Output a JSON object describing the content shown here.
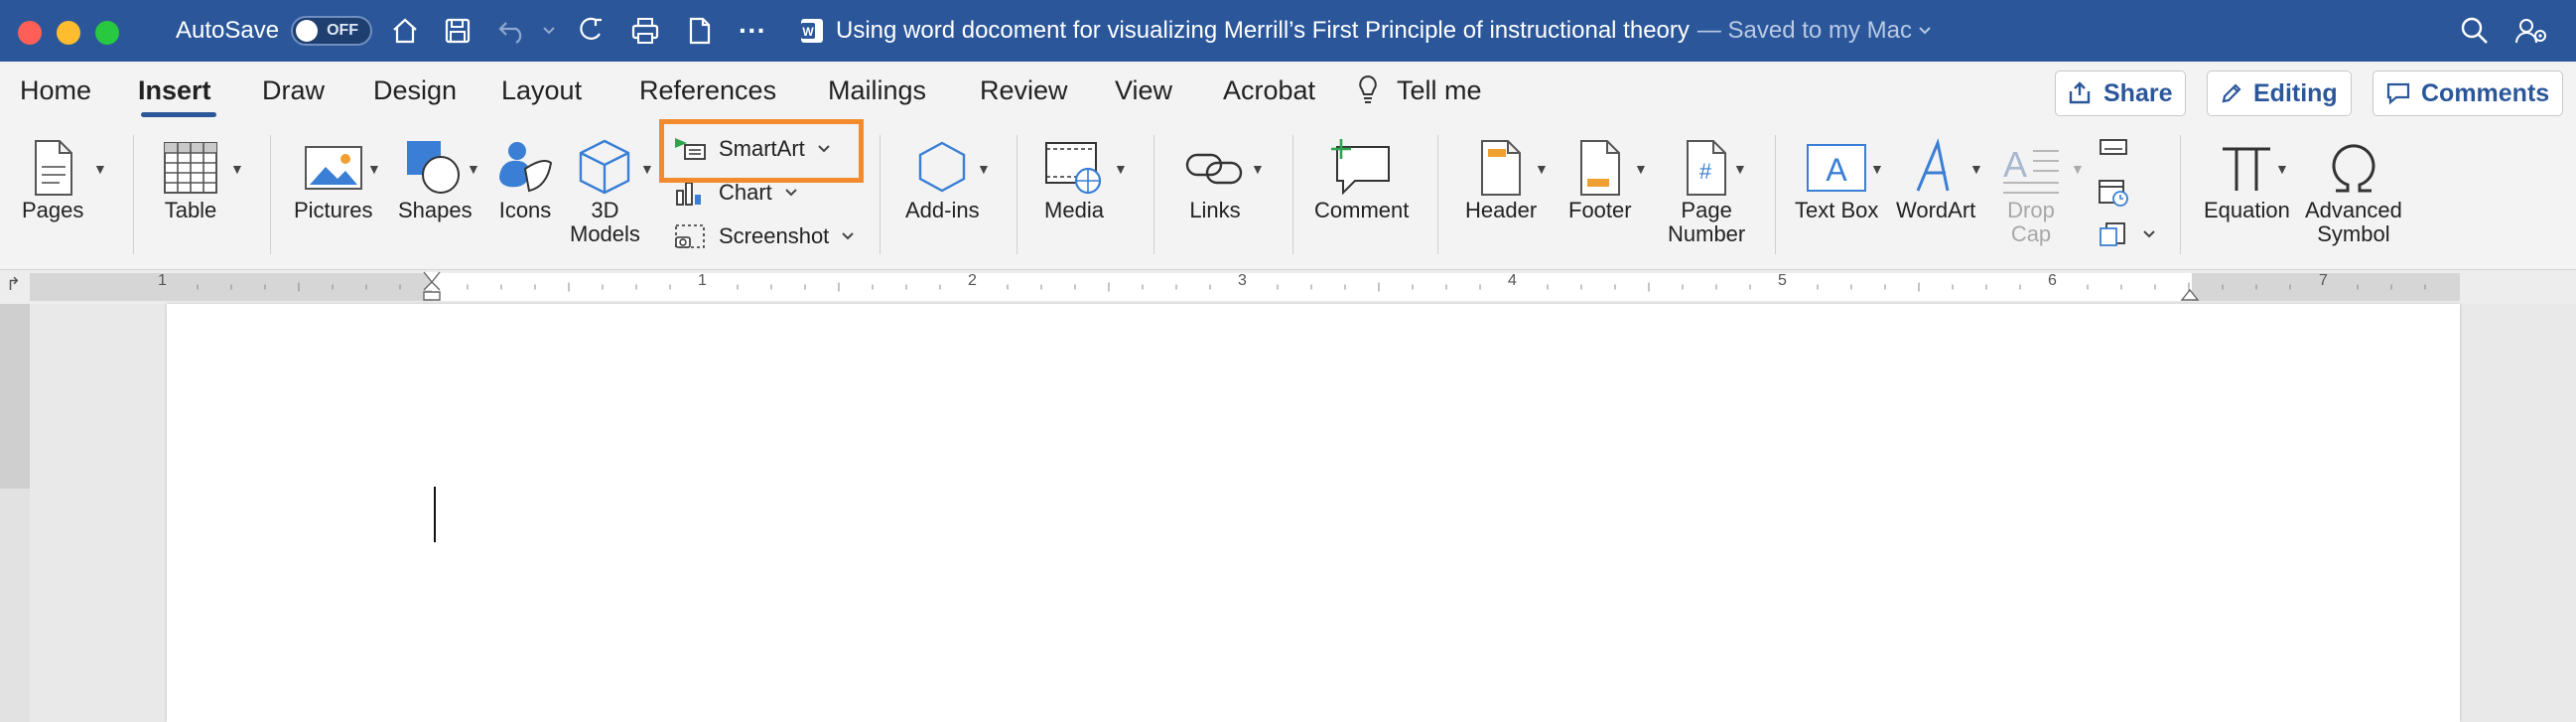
{
  "titlebar": {
    "autosave_label": "AutoSave",
    "autosave_state": "OFF",
    "doc_title": "Using word docoment for visualizing Merrill’s First Principle of instructional theory",
    "save_status": "— Saved to my Mac",
    "bg_color": "#2b579a"
  },
  "menu": {
    "tabs": [
      "Home",
      "Insert",
      "Draw",
      "Design",
      "Layout",
      "References",
      "Mailings",
      "Review",
      "View",
      "Acrobat",
      "Tell me"
    ],
    "active_tab": "Insert",
    "share_label": "Share",
    "editing_label": "Editing",
    "comments_label": "Comments"
  },
  "ribbon": {
    "pages": "Pages",
    "table": "Table",
    "pictures": "Pictures",
    "shapes": "Shapes",
    "icons": "Icons",
    "models_3d": "3D\nModels",
    "smartart": "SmartArt",
    "chart": "Chart",
    "screenshot": "Screenshot",
    "addins": "Add-ins",
    "media": "Media",
    "links": "Links",
    "comment": "Comment",
    "header": "Header",
    "footer": "Footer",
    "page_number": "Page\nNumber",
    "text_box": "Text Box",
    "wordart": "WordArt",
    "drop_cap": "Drop\nCap",
    "equation": "Equation",
    "advanced_symbol": "Advanced\nSymbol",
    "highlight_color": "#f28a2e"
  },
  "ruler": {
    "numbers": [
      "1",
      "1",
      "2",
      "3",
      "4",
      "5",
      "6",
      "7"
    ]
  }
}
